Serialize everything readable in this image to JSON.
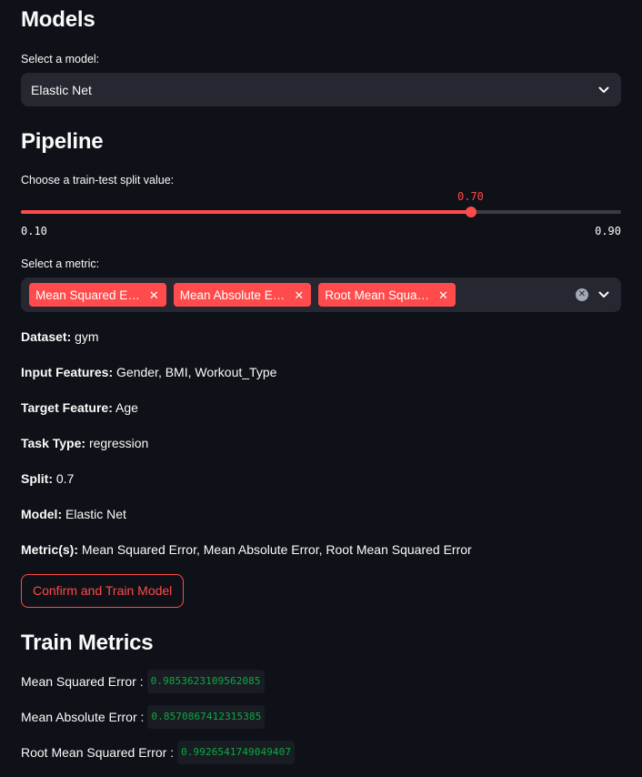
{
  "models": {
    "heading": "Models",
    "select_label": "Select a model:",
    "selected": "Elastic Net"
  },
  "pipeline": {
    "heading": "Pipeline",
    "split_label": "Choose a train-test split value:",
    "split_value": "0.70",
    "split_fraction": 0.75,
    "split_min": "0.10",
    "split_max": "0.90",
    "metric_label": "Select a metric:",
    "metric_tags": [
      "Mean Squared E…",
      "Mean Absolute E…",
      "Root Mean Squa…"
    ]
  },
  "summary": {
    "dataset_key": "Dataset:",
    "dataset_val": " gym",
    "input_key": "Input Features:",
    "input_val": " Gender, BMI, Workout_Type",
    "target_key": "Target Feature:",
    "target_val": " Age",
    "task_key": "Task Type:",
    "task_val": " regression",
    "split_key": "Split:",
    "split_val": " 0.7",
    "model_key": "Model:",
    "model_val": " Elastic Net",
    "metrics_key": "Metric(s):",
    "metrics_val": " Mean Squared Error, Mean Absolute Error, Root Mean Squared Error"
  },
  "actions": {
    "train_button": "Confirm and Train Model"
  },
  "train_metrics": {
    "heading": "Train Metrics",
    "rows": [
      {
        "label": "Mean Squared Error :",
        "value": "0.9853623109562085"
      },
      {
        "label": "Mean Absolute Error :",
        "value": "0.8570867412315385"
      },
      {
        "label": "Root Mean Squared Error :",
        "value": "0.9926541749049407"
      }
    ]
  },
  "colors": {
    "background": "#0e1117",
    "accent": "#ff4b4b",
    "widget_bg": "#262730",
    "code_green": "#09ab3b"
  }
}
